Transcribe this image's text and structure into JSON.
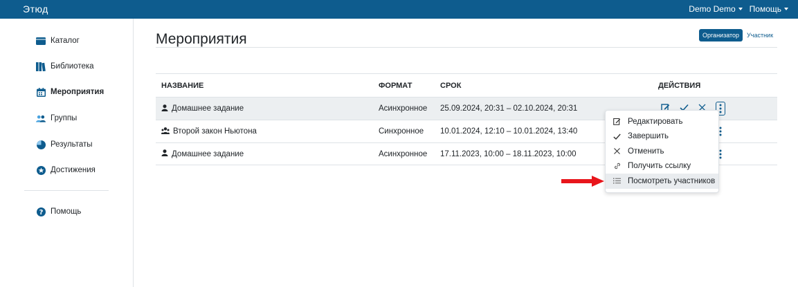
{
  "topbar": {
    "logo": "Этюд",
    "user_menu": "Demo Demo",
    "help_menu": "Помощь"
  },
  "sidebar": {
    "items": [
      {
        "label": "Каталог",
        "icon": "folder-icon",
        "active": false
      },
      {
        "label": "Библиотека",
        "icon": "books-icon",
        "active": false
      },
      {
        "label": "Мероприятия",
        "icon": "calendar-icon",
        "active": true
      },
      {
        "label": "Группы",
        "icon": "users-icon",
        "active": false
      },
      {
        "label": "Результаты",
        "icon": "pie-chart-icon",
        "active": false
      },
      {
        "label": "Достижения",
        "icon": "star-badge-icon",
        "active": false
      }
    ],
    "help": {
      "label": "Помощь",
      "icon": "question-icon"
    }
  },
  "main": {
    "title": "Мероприятия",
    "roles": {
      "active": "Организатор",
      "other": "Участник"
    },
    "table": {
      "headers": {
        "name": "НАЗВАНИЕ",
        "format": "ФОРМАТ",
        "term": "СРОК",
        "actions": "ДЕЙСТВИЯ"
      },
      "rows": [
        {
          "icon": "person-icon",
          "name": "Домашнее задание",
          "format": "Асинхронное",
          "term": "25.09.2024, 20:31 – 02.10.2024, 20:31"
        },
        {
          "icon": "group-icon",
          "name": "Второй закон Ньютона",
          "format": "Синхронное",
          "term": "10.01.2024, 12:10 – 10.01.2024, 13:40"
        },
        {
          "icon": "person-icon",
          "name": "Домашнее задание",
          "format": "Асинхронное",
          "term": "17.11.2023, 10:00 – 18.11.2023, 10:00"
        }
      ]
    }
  },
  "dropdown": {
    "items": [
      {
        "label": "Редактировать",
        "icon": "edit-icon"
      },
      {
        "label": "Завершить",
        "icon": "check-icon"
      },
      {
        "label": "Отменить",
        "icon": "close-icon"
      },
      {
        "label": "Получить ссылку",
        "icon": "link-icon"
      },
      {
        "label": "Посмотреть участников",
        "icon": "list-icon"
      }
    ]
  },
  "colors": {
    "brand": "#0e5c8e",
    "arrow": "#e8151b"
  }
}
